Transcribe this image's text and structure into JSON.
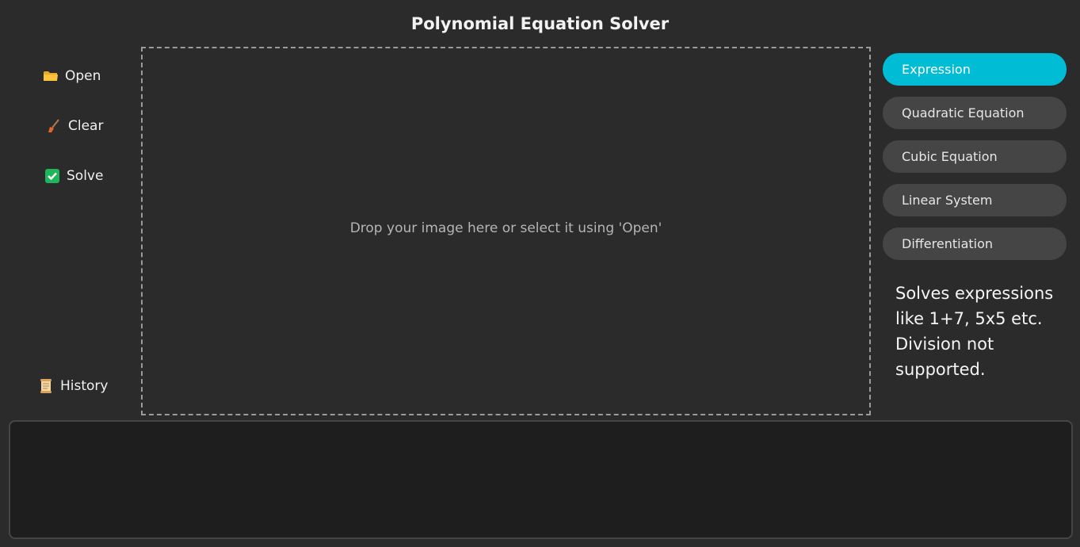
{
  "app": {
    "title": "Polynomial Equation Solver"
  },
  "sidebar": {
    "open_label": "Open",
    "open_icon": "folder-icon",
    "clear_label": "Clear",
    "clear_icon": "broom-icon",
    "solve_label": "Solve",
    "solve_icon": "checkmark-icon",
    "history_label": "History",
    "history_icon": "scroll-icon"
  },
  "dropzone": {
    "text": "Drop your image here or select it using 'Open'"
  },
  "modes": {
    "items": [
      {
        "label": "Expression",
        "active": true
      },
      {
        "label": "Quadratic Equation",
        "active": false
      },
      {
        "label": "Cubic Equation",
        "active": false
      },
      {
        "label": "Linear System",
        "active": false
      },
      {
        "label": "Differentiation",
        "active": false
      }
    ],
    "description": "Solves expressions like 1+7, 5x5 etc. Division not supported."
  },
  "colors": {
    "background": "#2b2b2b",
    "accent": "#00bcd4",
    "button": "#454545",
    "output_bg": "#1e1e1e"
  }
}
